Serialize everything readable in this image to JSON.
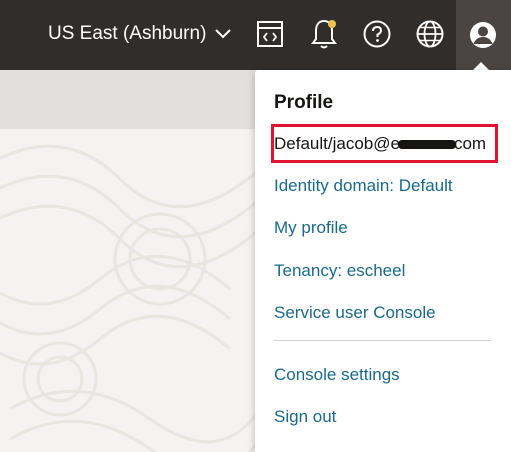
{
  "topbar": {
    "region_label": "US East (Ashburn)",
    "icons": [
      "chevron-down-icon",
      "code-editor-icon",
      "bell-icon",
      "help-icon",
      "globe-icon",
      "user-profile-icon"
    ],
    "notification_dot_color": "#f2c24f",
    "background": "#312d2a"
  },
  "profile_menu": {
    "title": "Profile",
    "user_prefix": "Default/jacob@e",
    "user_suffix": "com",
    "items": [
      "Identity domain: Default",
      "My profile",
      "Tenancy: escheel",
      "Service user Console"
    ],
    "footer_items": [
      "Console settings",
      "Sign out"
    ],
    "link_color": "#1b6a8a",
    "highlight_color": "#e3132f"
  }
}
